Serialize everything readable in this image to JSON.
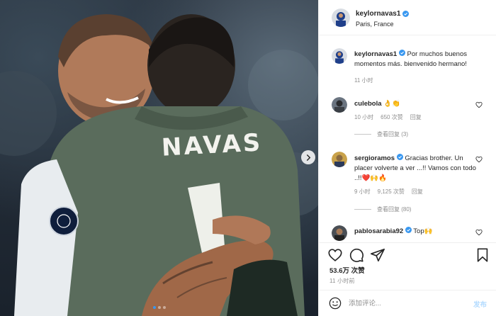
{
  "post": {
    "username": "keylornavas1",
    "location": "Paris, France",
    "jersey_name": "NAVAS"
  },
  "caption": {
    "username": "keylornavas1",
    "text": "Por muchos buenos momentos más. bienvenido hermano!",
    "time": "11 小时"
  },
  "comments": [
    {
      "username": "culebola",
      "text": "👌👏",
      "time": "10 小时",
      "likes": "650 次赞",
      "reply": "回复",
      "view_replies": "查看回复 (3)"
    },
    {
      "username": "sergioramos",
      "text": "Gracias brother. Un placer volverte a ver ...!! Vamos con todo ..!!❤️🙌🔥",
      "time": "9 小时",
      "likes": "9,125 次赞",
      "reply": "回复",
      "view_replies": "查看回复 (80)"
    },
    {
      "username": "pablosarabia92",
      "text": "Top🙌"
    }
  ],
  "actions": {
    "likes": "53.6万 次赞",
    "time_ago": "11 小时前"
  },
  "composer": {
    "placeholder": "添加评论...",
    "post_label": "发布"
  },
  "colors": {
    "verified": "#3897f0",
    "post_disabled": "#b3dbff",
    "secondary_text": "#8e8e8e"
  }
}
